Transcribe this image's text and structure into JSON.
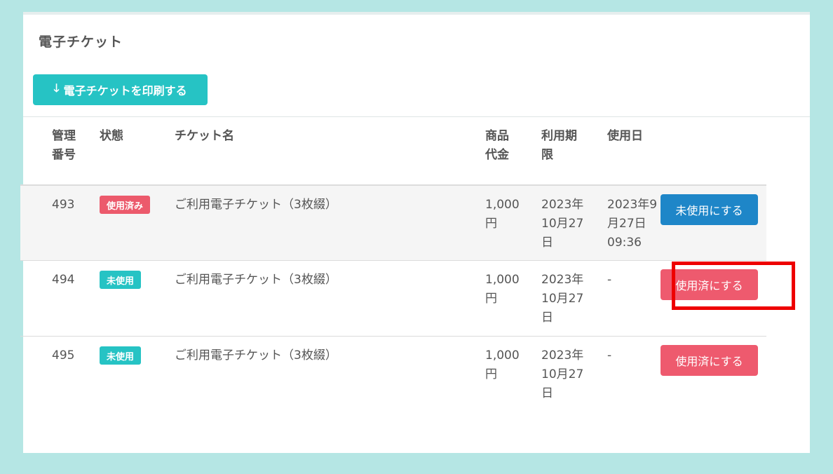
{
  "panel": {
    "title": "電子チケット",
    "print_button": {
      "icon": "arrow-down-icon",
      "glyph": "🡓",
      "label": "電子チケットを印刷する"
    }
  },
  "table": {
    "headers": {
      "id": "管理\n番号",
      "status": "状態",
      "name": "チケット名",
      "price": "商品\n代金",
      "period": "利用期\n限",
      "used_date": "使用日"
    },
    "rows": [
      {
        "id": "493",
        "status": "使用済み",
        "status_type": "used",
        "name": "ご利用電子チケット（3枚綴）",
        "price": "1,000\n円",
        "period": "2023年\n10月27\n日",
        "used_date": "2023年9\n月27日\n09:36",
        "action": "未使用にする",
        "action_color": "#1e86c8"
      },
      {
        "id": "494",
        "status": "未使用",
        "status_type": "unused",
        "name": "ご利用電子チケット（3枚綴）",
        "price": "1,000\n円",
        "period": "2023年\n10月27\n日",
        "used_date": "-",
        "action": "使用済にする",
        "action_color": "#ee5a6e"
      },
      {
        "id": "495",
        "status": "未使用",
        "status_type": "unused",
        "name": "ご利用電子チケット（3枚綴）",
        "price": "1,000\n円",
        "period": "2023年\n10月27\n日",
        "used_date": "-",
        "action": "使用済にする",
        "action_color": "#ee5a6e"
      }
    ]
  },
  "colors": {
    "background": "#b5e6e4",
    "accent_teal": "#26c3c4",
    "used_red": "#ec5a6c",
    "action_blue": "#1e86c8",
    "highlight_red": "#ee0000"
  }
}
